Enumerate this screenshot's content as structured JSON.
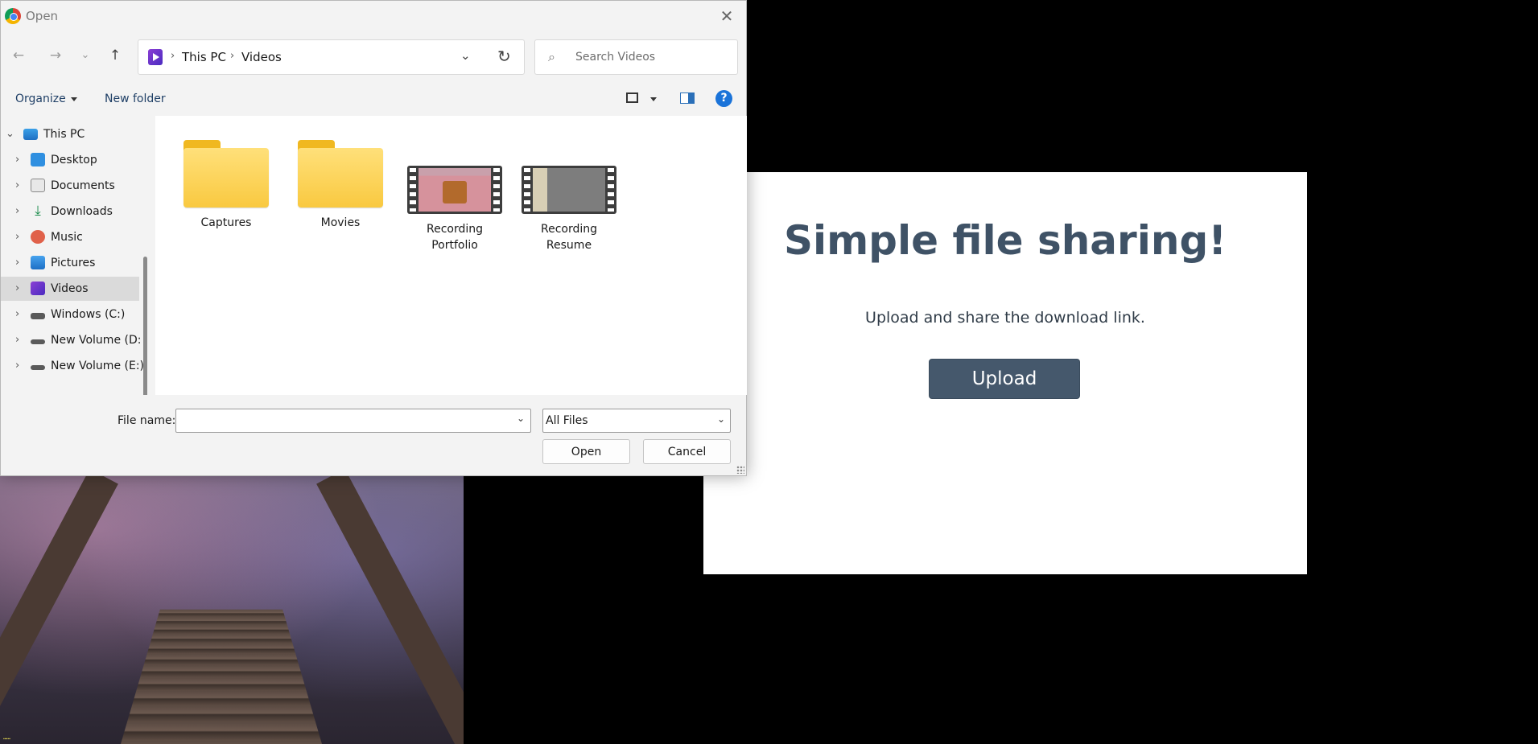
{
  "dialog": {
    "title": "Open",
    "close_glyph": "✕",
    "nav": {
      "back_glyph": "←",
      "forward_glyph": "→",
      "recent_glyph": "⌄",
      "up_glyph": "↑"
    },
    "breadcrumb": [
      "This PC",
      "Videos"
    ],
    "breadcrumb_sep": "›",
    "address_dropdown_glyph": "⌄",
    "refresh_glyph": "↻",
    "search_placeholder": "Search Videos",
    "search_glyph": "⌕",
    "commands": {
      "organize": "Organize",
      "new_folder": "New folder",
      "help": "?"
    },
    "tree": [
      {
        "label": "This PC",
        "icon": "pc-icon",
        "expanded": true
      },
      {
        "label": "Desktop",
        "icon": "desktop-icon"
      },
      {
        "label": "Documents",
        "icon": "documents-icon"
      },
      {
        "label": "Downloads",
        "icon": "downloads-icon"
      },
      {
        "label": "Music",
        "icon": "music-icon"
      },
      {
        "label": "Pictures",
        "icon": "pictures-icon"
      },
      {
        "label": "Videos",
        "icon": "videos-icon",
        "selected": true
      },
      {
        "label": "Windows (C:)",
        "icon": "drive-icon"
      },
      {
        "label": "New Volume (D:",
        "icon": "drive-icon"
      },
      {
        "label": "New Volume (E:)",
        "icon": "drive-icon"
      }
    ],
    "tree_chevron": "›",
    "tree_expanded_chevron": "⌄",
    "files": [
      {
        "name": "Captures",
        "type": "folder"
      },
      {
        "name": "Movies",
        "type": "folder"
      },
      {
        "name": "Recording Portfolio",
        "type": "video"
      },
      {
        "name": "Recording Resume",
        "type": "video"
      }
    ],
    "file_name_label": "File name:",
    "file_name_value": "",
    "file_type": "All Files",
    "select_chevron": "⌄",
    "open_button": "Open",
    "cancel_button": "Cancel"
  },
  "web": {
    "title": "Simple file sharing!",
    "subtitle": "Upload and share the download link.",
    "upload_button": "Upload"
  },
  "colors": {
    "accent": "#45586c",
    "title_color": "#3f5266",
    "selection": "#dadada",
    "folder": "#f9c940",
    "help_blue": "#1a73d9"
  }
}
